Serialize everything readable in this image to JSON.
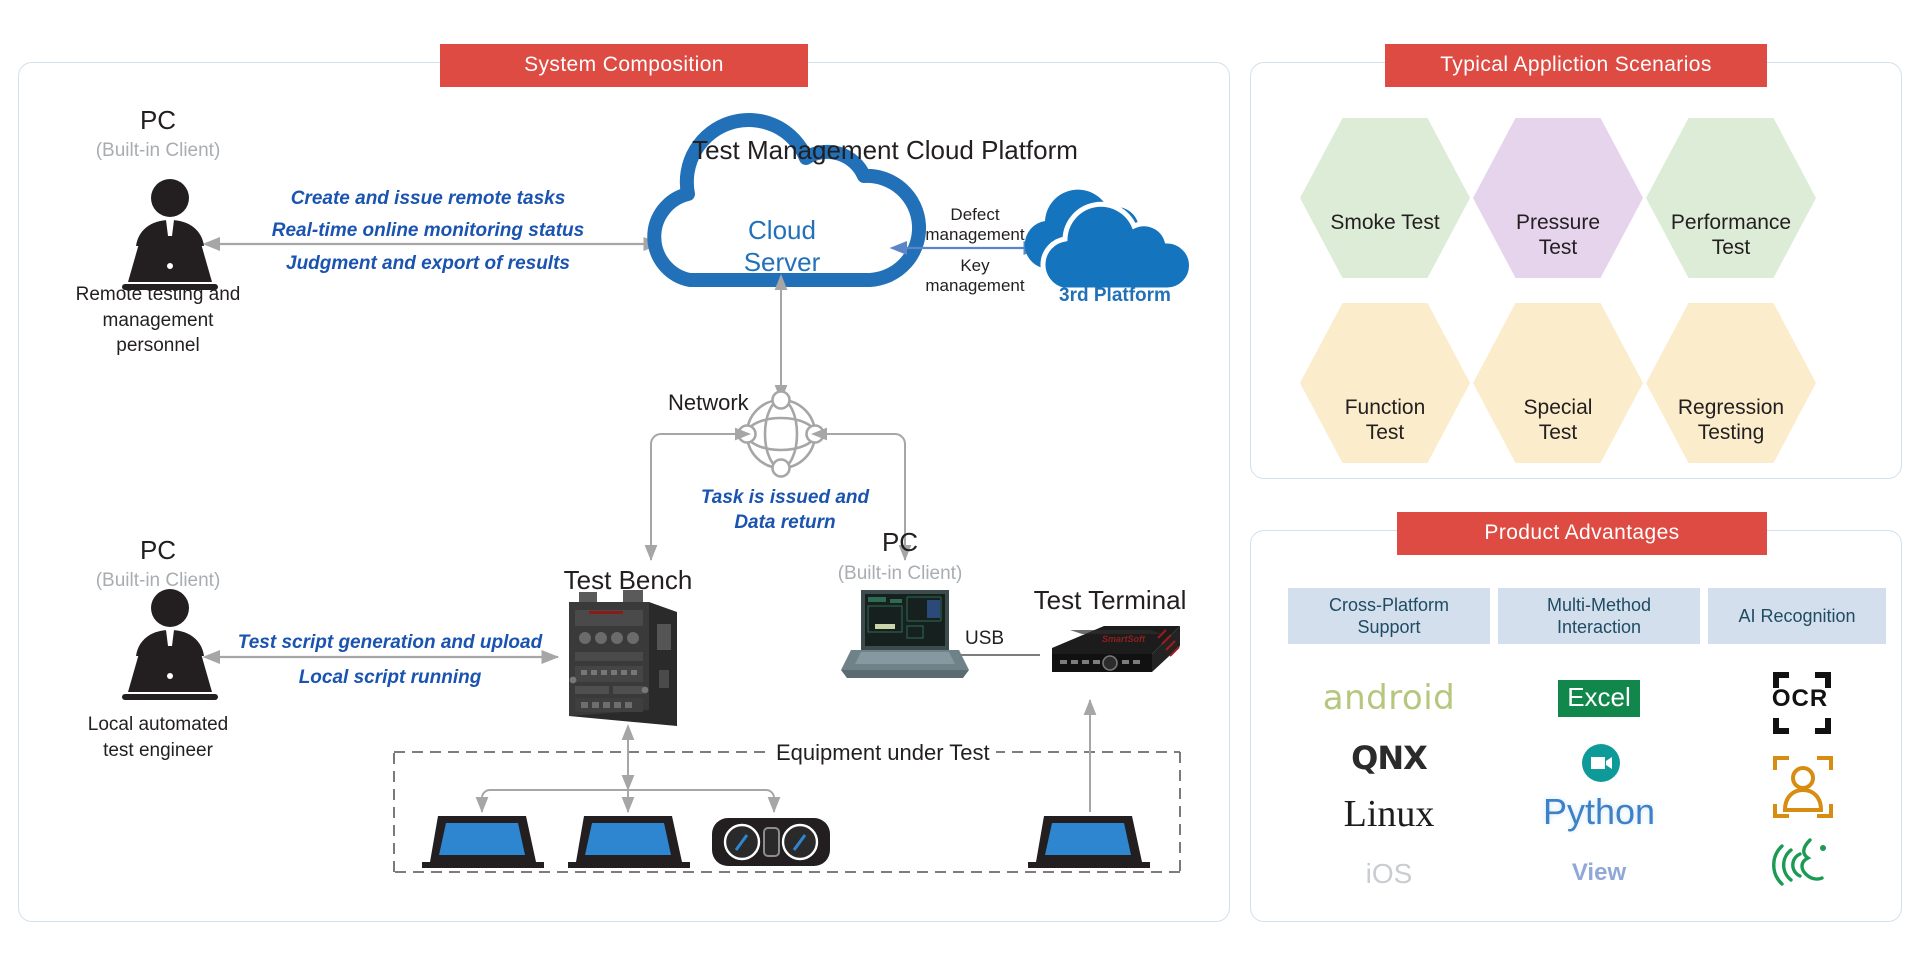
{
  "panels": {
    "system": {
      "title": "System Composition"
    },
    "scenarios": {
      "title": "Typical Appliction Scenarios"
    },
    "advantages": {
      "title": "Product Advantages"
    }
  },
  "system": {
    "cloud_platform_title": "Test Management Cloud Platform",
    "cloud_server_line1": "Cloud",
    "cloud_server_line2": "Server",
    "third_platform_label": "3rd Platform",
    "remote_pc": {
      "title": "PC",
      "subtitle": "(Built-in Client)",
      "role_line1": "Remote testing and",
      "role_line2": "management",
      "role_line3": "personnel"
    },
    "remote_flows": [
      "Create and issue remote tasks",
      "Real-time online monitoring status",
      "Judgment and export of results"
    ],
    "third_flows": [
      "Defect",
      "management",
      "Key",
      "management"
    ],
    "network_label": "Network",
    "network_flows": [
      "Task is issued and",
      "Data return"
    ],
    "local_pc": {
      "title": "PC",
      "subtitle": "(Built-in Client)",
      "role_line1": "Local automated",
      "role_line2": "test engineer"
    },
    "local_flows": [
      "Test script generation and upload",
      "Local script running"
    ],
    "test_bench_label": "Test Bench",
    "bench_pc": {
      "title": "PC",
      "subtitle": "(Built-in Client)"
    },
    "usb_label": "USB",
    "test_terminal_label": "Test Terminal",
    "eut_label": "Equipment under Test"
  },
  "scenarios": [
    {
      "label": "Smoke Test",
      "icon": "gears-cycle-icon",
      "fill": "#ddecd7",
      "accent": "#0f8a3c"
    },
    {
      "label": "Pressure\nTest",
      "icon": "down-arrows-icon",
      "fill": "#e5d4ec",
      "accent": "#8b3fa0"
    },
    {
      "label": "Performance\nTest",
      "icon": "gauge-icon",
      "fill": "#ddecd7",
      "accent": "#12b0ae"
    },
    {
      "label": "Function\nTest",
      "icon": "touch-screen-icon",
      "fill": "#fbeccb",
      "accent": "#8aa83c"
    },
    {
      "label": "Special\nTest",
      "icon": "wifi-icon",
      "fill": "#fbeccb",
      "accent": "#111111"
    },
    {
      "label": "Regression\nTesting",
      "icon": "bug-icon",
      "fill": "#fbeccb",
      "accent": "#d0221f"
    }
  ],
  "advantages": {
    "columns": [
      {
        "header": "Cross-Platform\nSupport",
        "items": [
          "android",
          "QNX",
          "Linux",
          "iOS"
        ]
      },
      {
        "header": "Multi-Method\nInteraction",
        "items": [
          "Excel",
          "video-camera-icon",
          "Python",
          "View"
        ]
      },
      {
        "header": "AI Recognition",
        "items": [
          "OCR",
          "face-recognition-icon",
          "voice-recognition-icon"
        ]
      }
    ]
  },
  "colors": {
    "title_red": "#dd4b43",
    "panel_border": "#cfe0ef",
    "cloud_blue": "#2271b8",
    "flow_blue": "#1a54b0",
    "arrow_grey": "#a6a6a6",
    "adv_head_bg": "#d3dfec"
  }
}
